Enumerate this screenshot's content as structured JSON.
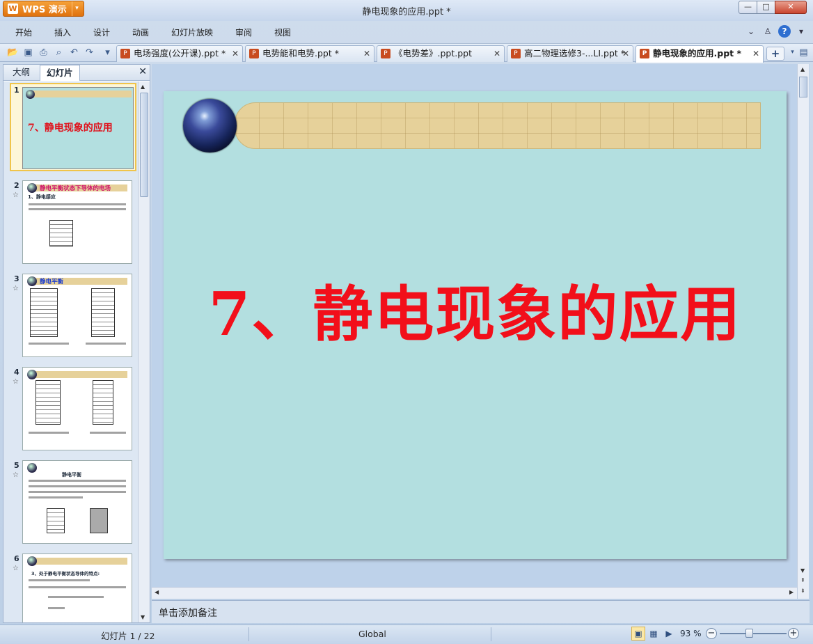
{
  "app": {
    "button_label": "WPS 演示",
    "window_title": "静电现象的应用.ppt *"
  },
  "menu": [
    "开始",
    "插入",
    "设计",
    "动画",
    "幻灯片放映",
    "审阅",
    "视图"
  ],
  "doc_tabs": [
    {
      "label": "电场强度(公开课).ppt *"
    },
    {
      "label": "电势能和电势.ppt *"
    },
    {
      "label": "《电势差》.ppt.ppt"
    },
    {
      "label": "高二物理选修3-...LI.ppt *"
    },
    {
      "label": "静电现象的应用.ppt *",
      "active": true
    }
  ],
  "panel": {
    "tab_outline": "大纲",
    "tab_slides": "幻灯片"
  },
  "thumbnails": [
    {
      "num": "1",
      "title": "7、静电现象的应用"
    },
    {
      "num": "2",
      "title": "静电平衡状态下导体的电场",
      "sub": "1、静电感应"
    },
    {
      "num": "3",
      "title": "静电平衡"
    },
    {
      "num": "4",
      "title": ""
    },
    {
      "num": "5",
      "title": "静电平衡"
    },
    {
      "num": "6",
      "title": "3、处于静电平衡状态导体的特点:"
    }
  ],
  "slide": {
    "title": "7、静电现象的应用"
  },
  "notes": {
    "placeholder": "单击添加备注"
  },
  "status": {
    "slide_counter": "幻灯片 1 / 22",
    "theme": "Global",
    "zoom": "93 %"
  },
  "colors": {
    "title_red": "#f20f1a",
    "slide_bg": "#b3dfe0",
    "map_band": "#e6d19a"
  }
}
